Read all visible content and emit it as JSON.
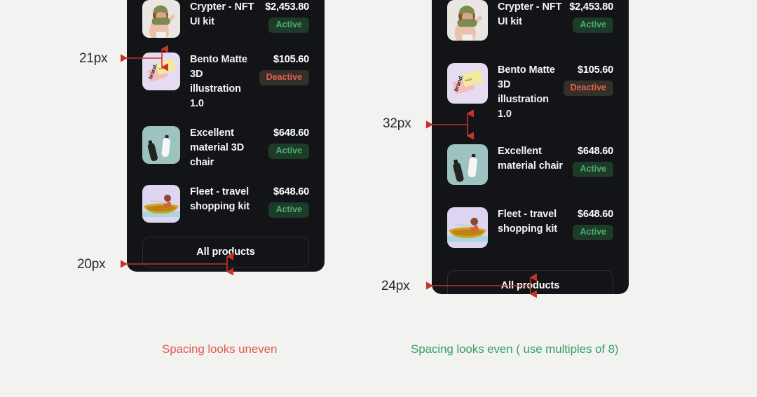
{
  "theme": {
    "page_bg": "#f2f2f0",
    "panel_bg": "#131417",
    "text_primary": "#ffffff",
    "badge_active_bg": "#1d3b27",
    "badge_active_fg": "#4bae72",
    "badge_deactive_bg": "#33302a",
    "badge_deactive_fg": "#e2604f",
    "annotation_red": "#c8322a",
    "caption_bad": "#e05c52",
    "caption_good": "#36a06a"
  },
  "panels": [
    {
      "id": "uneven",
      "products": [
        {
          "thumb": "nft-portrait-thumbnail",
          "title": "Crypter - NFT UI kit",
          "price": "$2,453.80",
          "status": "Active",
          "status_kind": "active"
        },
        {
          "thumb": "bento-cards-thumbnail",
          "title": "Bento Matte 3D illustration 1.0",
          "price": "$105.60",
          "status": "Deactive",
          "status_kind": "deactive"
        },
        {
          "thumb": "water-bottles-thumbnail",
          "title": "Excellent material 3D chair",
          "price": "$648.60",
          "status": "Active",
          "status_kind": "active"
        },
        {
          "thumb": "kayak-thumbnail",
          "title": "Fleet - travel shopping kit",
          "price": "$648.60",
          "status": "Active",
          "status_kind": "active"
        }
      ],
      "all_products_label": "All products",
      "caption": "Spacing looks uneven",
      "annotations": [
        {
          "name": "row-gap-measure",
          "value": "21px"
        },
        {
          "name": "bottom-padding-measure",
          "value": "20px"
        }
      ]
    },
    {
      "id": "even",
      "products": [
        {
          "thumb": "nft-portrait-thumbnail",
          "title": "Crypter - NFT UI kit",
          "price": "$2,453.80",
          "status": "Active",
          "status_kind": "active"
        },
        {
          "thumb": "bento-cards-thumbnail",
          "title": "Bento Matte 3D illustration 1.0",
          "price": "$105.60",
          "status": "Deactive",
          "status_kind": "deactive"
        },
        {
          "thumb": "water-bottles-thumbnail",
          "title": "Excellent material chair",
          "price": "$648.60",
          "status": "Active",
          "status_kind": "active"
        },
        {
          "thumb": "kayak-thumbnail",
          "title": "Fleet - travel shopping kit",
          "price": "$648.60",
          "status": "Active",
          "status_kind": "active"
        }
      ],
      "all_products_label": "All products",
      "caption": "Spacing looks even ( use multiples of 8)",
      "annotations": [
        {
          "name": "row-gap-measure",
          "value": "32px"
        },
        {
          "name": "bottom-padding-measure",
          "value": "24px"
        }
      ]
    }
  ]
}
